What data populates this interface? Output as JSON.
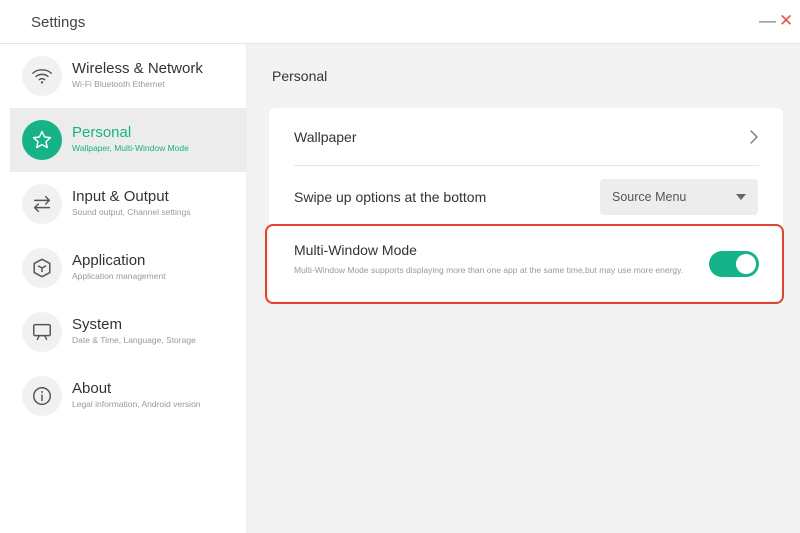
{
  "window": {
    "title": "Settings",
    "minimize_glyph": "—",
    "close_glyph": "✕"
  },
  "sidebar": {
    "items": [
      {
        "label": "Wireless & Network",
        "sub": "Wi-Fi Bluetooth Ethernet",
        "icon": "wifi-icon",
        "active": false
      },
      {
        "label": "Personal",
        "sub": "Wallpaper, Multi-Window Mode",
        "icon": "star-icon",
        "active": true
      },
      {
        "label": "Input & Output",
        "sub": "Sound output, Channel settings",
        "icon": "swap-arrows-icon",
        "active": false
      },
      {
        "label": "Application",
        "sub": "Application management",
        "icon": "cube-icon",
        "active": false
      },
      {
        "label": "System",
        "sub": "Date & Time, Language, Storage",
        "icon": "monitor-icon",
        "active": false
      },
      {
        "label": "About",
        "sub": "Legal information, Android version",
        "icon": "info-icon",
        "active": false
      }
    ]
  },
  "main": {
    "section_title": "Personal",
    "wallpaper": {
      "label": "Wallpaper"
    },
    "swipe": {
      "label": "Swipe up options at the bottom",
      "value": "Source Menu"
    },
    "multi_window": {
      "label": "Multi-Window Mode",
      "description": "Multi-Window Mode supports displaying more than one app at the same time,but may use more energy.",
      "enabled": true
    }
  },
  "colors": {
    "accent": "#16b388",
    "close": "#e2574c",
    "highlight": "#e0442e"
  }
}
